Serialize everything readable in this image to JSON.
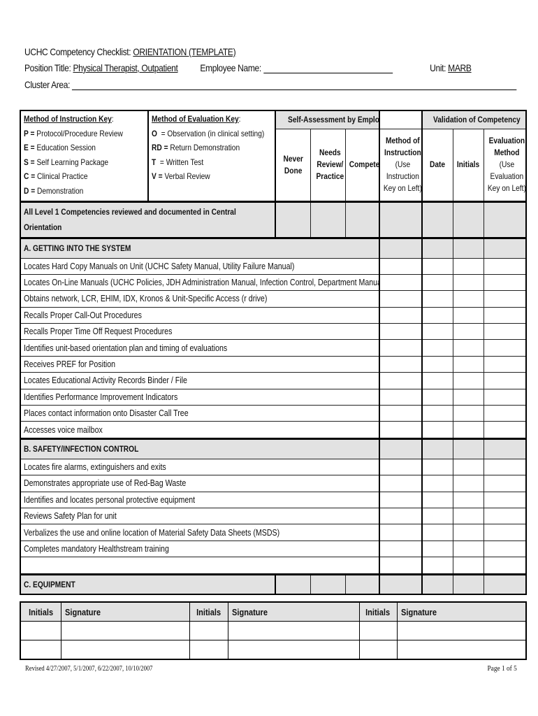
{
  "header": {
    "checklist_label": "UCHC Competency Checklist:",
    "checklist_value": "ORIENTATION  (TEMPLATE)",
    "position_label": "Position Title:",
    "position_value": "Physical Therapist, Outpatient",
    "employee_label": "Employee Name:",
    "employee_value": "",
    "unit_label": "Unit:",
    "unit_value": "MARB",
    "cluster_label": "Cluster Area:",
    "cluster_value": ""
  },
  "instruction_key": {
    "title": "Method of Instruction Key",
    "items": [
      {
        "code": "P =",
        "label": "Protocol/Procedure Review"
      },
      {
        "code": "E =",
        "label": "Education Session"
      },
      {
        "code": "S =",
        "label": "Self Learning Package"
      },
      {
        "code": "C =",
        "label": "Clinical Practice"
      },
      {
        "code": "D =",
        "label": "Demonstration"
      }
    ]
  },
  "evaluation_key": {
    "title": "Method of Evaluation Key",
    "items": [
      {
        "code": "O",
        "label": "= Observation (in clinical setting)"
      },
      {
        "code": "RD =",
        "label": "Return Demonstration"
      },
      {
        "code": "T",
        "label": "= Written Test"
      },
      {
        "code": "V =",
        "label": "Verbal Review"
      }
    ]
  },
  "columns": {
    "self_assessment": "Self-Assessment by Employee",
    "validation": "Validation of Competency",
    "never_done": [
      "Never",
      "Done"
    ],
    "needs_review": [
      "Needs",
      "Review/",
      "Practice"
    ],
    "competent": "Competent",
    "method_instruction": [
      "Method of",
      "Instruction",
      "(Use",
      "Instruction",
      "Key on Left)"
    ],
    "date": "Date",
    "initials": "Initials",
    "evaluation_method": [
      "Evaluation",
      "Method",
      "(Use",
      "Evaluation",
      "Key on Left)"
    ]
  },
  "level1_row": "All Level 1 Competencies reviewed and documented in Central Orientation",
  "sections": [
    {
      "title": "A.  GETTING INTO THE SYSTEM",
      "items": [
        "Locates Hard Copy Manuals on Unit (UCHC Safety Manual, Utility Failure Manual)",
        "Locates On-Line Manuals (UCHC Policies, JDH Administration Manual, Infection Control, Department Manual)",
        "Obtains network, LCR, EHIM, IDX, Kronos & Unit-Specific Access (r drive)",
        "Recalls Proper Call-Out Procedures",
        "Recalls Proper Time Off Request Procedures",
        "Identifies unit-based orientation plan and timing of evaluations",
        "Receives PREF for Position",
        "Locates Educational Activity Records Binder / File",
        "Identifies Performance Improvement Indicators",
        "Places contact information onto Disaster Call Tree",
        "Accesses voice mailbox"
      ]
    },
    {
      "title": "B. SAFETY/INFECTION CONTROL",
      "items": [
        "Locates fire alarms, extinguishers and exits",
        "Demonstrates appropriate use of Red-Bag Waste",
        "Identifies and locates personal protective equipment",
        "Reviews Safety Plan for unit",
        "Verbalizes the use and online location of Material Safety Data Sheets (MSDS)",
        "Completes mandatory Healthstream training",
        ""
      ]
    },
    {
      "title": "C. EQUIPMENT",
      "items": []
    }
  ],
  "signature_table": {
    "headers": [
      "Initials",
      "Signature",
      "Initials",
      "Signature",
      "Initials",
      "Signature"
    ],
    "rows": 2
  },
  "footer": {
    "revised": "Revised 4/27/2007, 5/1/2007, 6/22/2007, 10/10/2007",
    "page": "Page 1 of 5"
  }
}
